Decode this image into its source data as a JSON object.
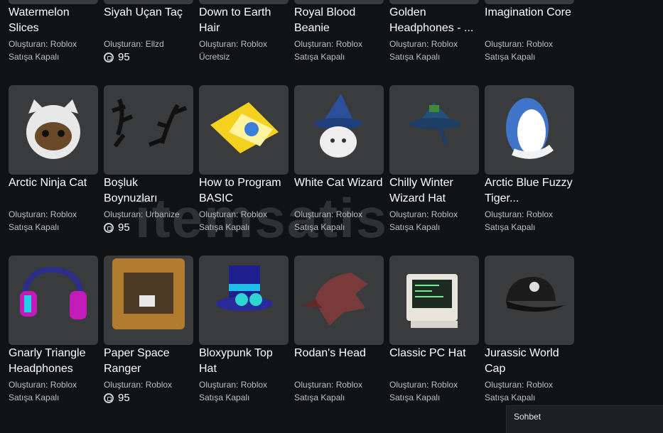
{
  "items": [
    {
      "name": "Watermelon Slices",
      "by": "Oluşturan:",
      "creator": "Roblox",
      "status": "Satışa Kapalı",
      "price": null,
      "icon": "watermelon-icon"
    },
    {
      "name": "Siyah Uçan Taç",
      "by": "Oluşturan:",
      "creator": "Ellzd",
      "status": null,
      "price": "95",
      "icon": "crown-icon"
    },
    {
      "name": "Down to Earth Hair",
      "by": "Oluşturan:",
      "creator": "Roblox",
      "status": "Ücretsiz",
      "price": null,
      "icon": "hair-icon"
    },
    {
      "name": "Royal Blood Beanie",
      "by": "Oluşturan:",
      "creator": "Roblox",
      "status": "Satışa Kapalı",
      "price": null,
      "icon": "beanie-icon"
    },
    {
      "name": "Golden Headphones - ...",
      "by": "Oluşturan:",
      "creator": "Roblox",
      "status": "Satışa Kapalı",
      "price": null,
      "icon": "headphones-icon"
    },
    {
      "name": "Imagination Core",
      "by": "Oluşturan:",
      "creator": "Roblox",
      "status": "Satışa Kapalı",
      "price": null,
      "icon": "core-icon"
    },
    {
      "name": "Arctic Ninja Cat",
      "by": "Oluşturan:",
      "creator": "Roblox",
      "status": "Satışa Kapalı",
      "price": null,
      "icon": "ninja-cat-icon"
    },
    {
      "name": "Boşluk Boynuzları",
      "by": "Oluşturan:",
      "creator": "Urbanize",
      "status": null,
      "price": "95",
      "icon": "antlers-icon"
    },
    {
      "name": "How to Program BASIC",
      "by": "Oluşturan:",
      "creator": "Roblox",
      "status": "Satışa Kapalı",
      "price": null,
      "icon": "book-icon"
    },
    {
      "name": "White Cat Wizard",
      "by": "Oluşturan:",
      "creator": "Roblox",
      "status": "Satışa Kapalı",
      "price": null,
      "icon": "cat-wizard-icon"
    },
    {
      "name": "Chilly Winter Wizard Hat",
      "by": "Oluşturan:",
      "creator": "Roblox",
      "status": "Satışa Kapalı",
      "price": null,
      "icon": "wizard-hat-icon"
    },
    {
      "name": "Arctic Blue Fuzzy Tiger...",
      "by": "Oluşturan:",
      "creator": "Roblox",
      "status": "Satışa Kapalı",
      "price": null,
      "icon": "tiger-hood-icon"
    },
    {
      "name": "Gnarly Triangle Headphones",
      "by": "Oluşturan:",
      "creator": "Roblox",
      "status": "Satışa Kapalı",
      "price": null,
      "icon": "neon-headphones-icon"
    },
    {
      "name": "Paper Space Ranger",
      "by": "Oluşturan:",
      "creator": "Roblox",
      "status": null,
      "price": "95",
      "icon": "box-helmet-icon"
    },
    {
      "name": "Bloxypunk Top Hat",
      "by": "Oluşturan:",
      "creator": "Roblox",
      "status": "Satışa Kapalı",
      "price": null,
      "icon": "top-hat-icon"
    },
    {
      "name": "Rodan's Head",
      "by": "Oluşturan:",
      "creator": "Roblox",
      "status": "Satışa Kapalı",
      "price": null,
      "icon": "dragon-head-icon"
    },
    {
      "name": "Classic PC Hat",
      "by": "Oluşturan:",
      "creator": "Roblox",
      "status": "Satışa Kapalı",
      "price": null,
      "icon": "pc-hat-icon"
    },
    {
      "name": "Jurassic World Cap",
      "by": "Oluşturan:",
      "creator": "Roblox",
      "status": "Satışa Kapalı",
      "price": null,
      "icon": "cap-icon"
    }
  ],
  "chat": {
    "label": "Sohbet"
  },
  "watermark": {
    "text": "itemsatis"
  }
}
